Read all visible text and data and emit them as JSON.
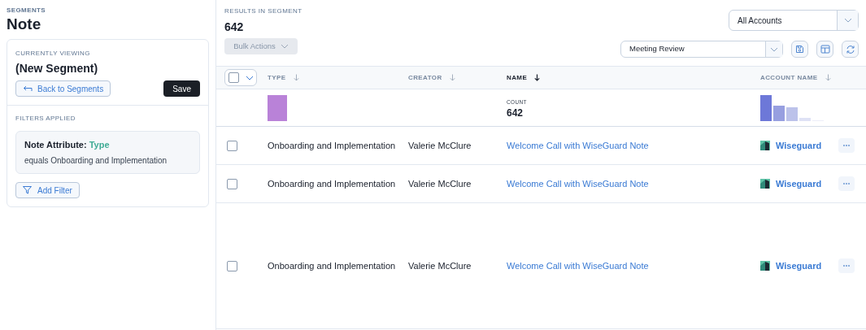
{
  "sidebar": {
    "eyebrow": "SEGMENTS",
    "title": "Note",
    "current": {
      "label": "CURRENTLY VIEWING",
      "name": "(New Segment)",
      "back_button": "Back to Segments",
      "save_button": "Save"
    },
    "filters": {
      "label": "FILTERS APPLIED",
      "items": [
        {
          "attribute": "Note Attribute: ",
          "field": "Type",
          "condition": "equals Onboarding and Implementation"
        }
      ],
      "add_button": "Add Filter"
    }
  },
  "results": {
    "label": "RESULTS IN SEGMENT",
    "count": "642",
    "bulk_actions": "Bulk Actions",
    "account_filter": "All Accounts",
    "view": "Meeting Review"
  },
  "table": {
    "select_all": {
      "checked": false
    },
    "columns": [
      {
        "label": "TYPE",
        "active": false
      },
      {
        "label": "CREATOR",
        "active": false
      },
      {
        "label": "NAME",
        "active": true
      },
      {
        "label": "ACCOUNT NAME",
        "active": false
      }
    ],
    "summary": {
      "label": "COUNT",
      "value": "642"
    },
    "rows": [
      {
        "checked": false,
        "type": "Onboarding and Implementation",
        "creator": "Valerie McClure",
        "name": "Welcome Call with WiseGuard Note",
        "account": "Wiseguard",
        "tall": false
      },
      {
        "checked": false,
        "type": "Onboarding and Implementation",
        "creator": "Valerie McClure",
        "name": "Welcome Call with WiseGuard Note",
        "account": "Wiseguard",
        "tall": false
      },
      {
        "checked": false,
        "type": "Onboarding and Implementation",
        "creator": "Valerie McClure",
        "name": "Welcome Call with WiseGuard Note",
        "account": "Wiseguard",
        "tall": true
      }
    ]
  }
}
